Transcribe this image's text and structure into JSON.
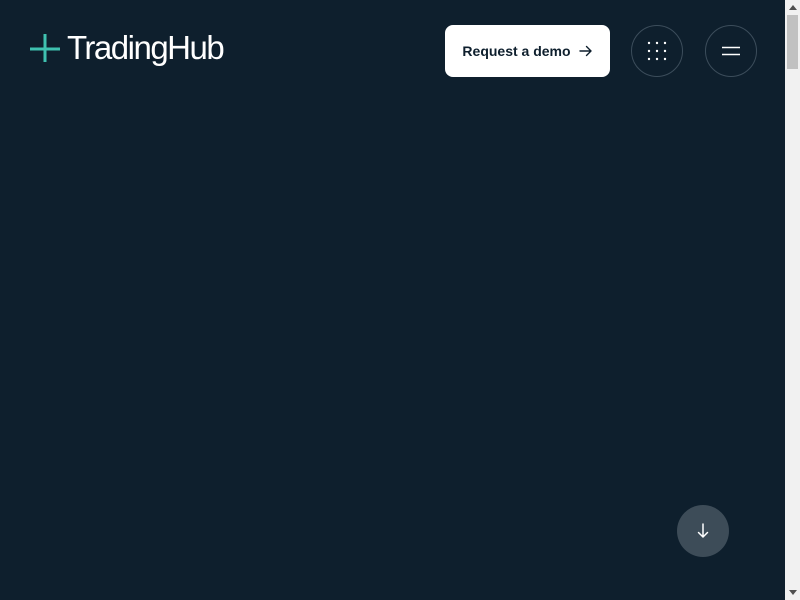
{
  "header": {
    "logo_text": "TradingHub",
    "logo_icon": "plus-cross-icon",
    "logo_accent_color": "#3fc1b0",
    "demo_button_label": "Request a demo",
    "demo_button_icon": "arrow-right-icon",
    "apps_button_icon": "grid-dots-icon",
    "menu_button_icon": "hamburger-icon"
  },
  "main": {
    "background_color": "#0e1f2d",
    "scroll_down_icon": "arrow-down-icon"
  },
  "scrollbar": {
    "up_icon": "triangle-up-icon",
    "down_icon": "triangle-down-icon"
  }
}
